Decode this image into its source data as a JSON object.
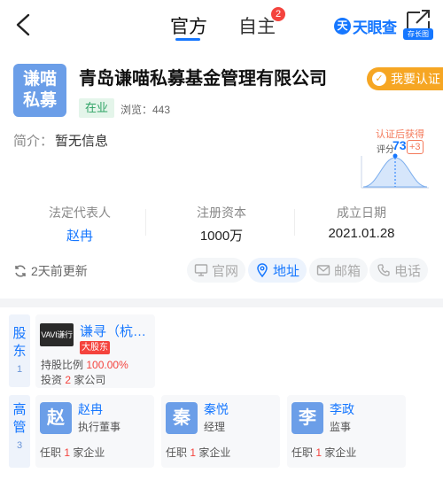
{
  "nav": {
    "tabs": [
      {
        "label": "官方",
        "active": true
      },
      {
        "label": "自主",
        "active": false,
        "badge": "2"
      }
    ],
    "brand_mark": "天",
    "brand": "天眼查",
    "screenshot_label": "存长图"
  },
  "company": {
    "logo_line1": "谦喵",
    "logo_line2": "私募",
    "name": "青岛谦喵私募基金管理有限公司",
    "verify_label": "我要认证",
    "status": "在业",
    "views": "浏览：443"
  },
  "intro": {
    "label": "简介：",
    "value": "暂无信息"
  },
  "promo": {
    "title": "认证后获得",
    "score_label": "评分",
    "score": "73",
    "bonus": "+3"
  },
  "key_info": [
    {
      "label": "法定代表人",
      "value": "赵冉",
      "link": true
    },
    {
      "label": "注册资本",
      "value": "1000万",
      "link": false
    },
    {
      "label": "成立日期",
      "value": "2021.01.28",
      "link": false
    }
  ],
  "updated": "2天前更新",
  "actions": [
    {
      "label": "官网",
      "enabled": false
    },
    {
      "label": "地址",
      "enabled": true
    },
    {
      "label": "邮箱",
      "enabled": false
    },
    {
      "label": "电话",
      "enabled": false
    }
  ],
  "shareholders": {
    "section_char1": "股",
    "section_char2": "东",
    "count": "1",
    "items": [
      {
        "logo_text": "VAVI谦行",
        "name": "谦寻（杭…",
        "tag": "大股东",
        "ratio_label": "持股比例",
        "ratio": "100.00%",
        "invest_prefix": "投资",
        "invest_count": "2",
        "invest_suffix": "家公司"
      }
    ]
  },
  "managers": {
    "section_char1": "高",
    "section_char2": "管",
    "count": "3",
    "items": [
      {
        "avatar": "赵",
        "name": "赵冉",
        "role": "执行董事",
        "office_prefix": "任职",
        "office_count": "1",
        "office_suffix": "家企业"
      },
      {
        "avatar": "秦",
        "name": "秦悦",
        "role": "经理",
        "office_prefix": "任职",
        "office_count": "1",
        "office_suffix": "家企业"
      },
      {
        "avatar": "李",
        "name": "李政",
        "role": "监事",
        "office_prefix": "任职",
        "office_count": "1",
        "office_suffix": "家企业"
      }
    ]
  },
  "colors": {
    "accent": "#1677ff",
    "verify": "#f6a623",
    "status_green": "#2da264",
    "highlight_red": "#f4433d"
  }
}
